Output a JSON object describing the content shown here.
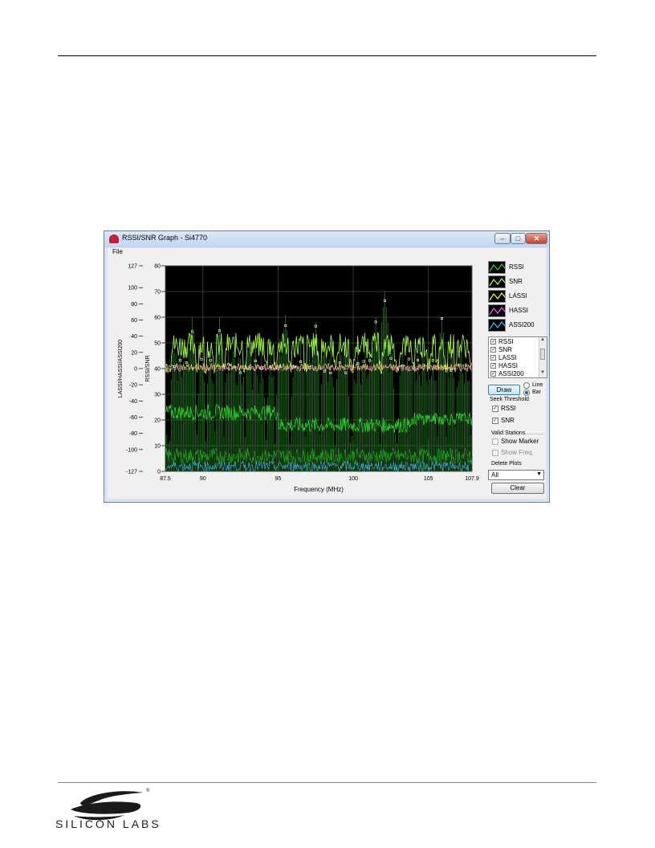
{
  "window": {
    "title": "RSSI/SNR Graph - Si4770",
    "controls": {
      "minimize": "–",
      "maximize": "□",
      "close": "✕"
    }
  },
  "menu": {
    "file": "File"
  },
  "chart_data": {
    "type": "line",
    "xlabel": "Frequency (MHz)",
    "ylabel_left": "LASSI/HASSI/ASSI200",
    "ylabel_right": "RSSI/SNR",
    "x_ticks": [
      "87.5",
      "90",
      "95",
      "100",
      "105",
      "107.9"
    ],
    "x_range": [
      87.5,
      107.9
    ],
    "y_ticks_rssi": [
      "80",
      "70",
      "60",
      "50",
      "40",
      "30",
      "20",
      "10",
      "0"
    ],
    "y_range_rssi": [
      0,
      80
    ],
    "y_ticks_assi": [
      "127",
      "100",
      "80",
      "60",
      "40",
      "20",
      "0",
      "-20",
      "-40",
      "-60",
      "-80",
      "-100",
      "-127"
    ],
    "y_range_assi": [
      -127,
      127
    ],
    "grid": true,
    "background": "#000000",
    "series": [
      {
        "name": "RSSI",
        "color": "#2bd92b"
      },
      {
        "name": "SNR",
        "color": "#a8ff3c"
      },
      {
        "name": "LASSI",
        "color": "#ffff40"
      },
      {
        "name": "HASSI",
        "color": "#ff5cff"
      },
      {
        "name": "ASSI200",
        "color": "#3cbcff"
      }
    ]
  },
  "legend": [
    {
      "label": "RSSI",
      "color": "#2bd92b"
    },
    {
      "label": "SNR",
      "color": "#a8ff3c"
    },
    {
      "label": "LASSI",
      "color": "#ffff40"
    },
    {
      "label": "HASSI",
      "color": "#ff5cff"
    },
    {
      "label": "ASSI200",
      "color": "#3cbcff"
    }
  ],
  "plot_list": [
    {
      "label": "RSSI",
      "checked": true
    },
    {
      "label": "SNR",
      "checked": true
    },
    {
      "label": "LASSI",
      "checked": true
    },
    {
      "label": "HASSI",
      "checked": true
    },
    {
      "label": "ASSI200",
      "checked": true
    }
  ],
  "controls": {
    "draw": "Draw",
    "line_label": "Line",
    "bar_label": "Bar",
    "plot_style": "Bar",
    "seek_threshold": "Seek Threshold",
    "seek_rssi": "RSSI",
    "seek_snr": "SNR",
    "valid_stations": "Valid Stations",
    "show_marker": "Show Marker",
    "show_freq": "Show Freq.",
    "delete_plots": "Delete Plots",
    "delete_selection": "All",
    "clear": "Clear"
  },
  "footer": {
    "logo_text": "SILICON LABS",
    "logo_mark": "®"
  }
}
